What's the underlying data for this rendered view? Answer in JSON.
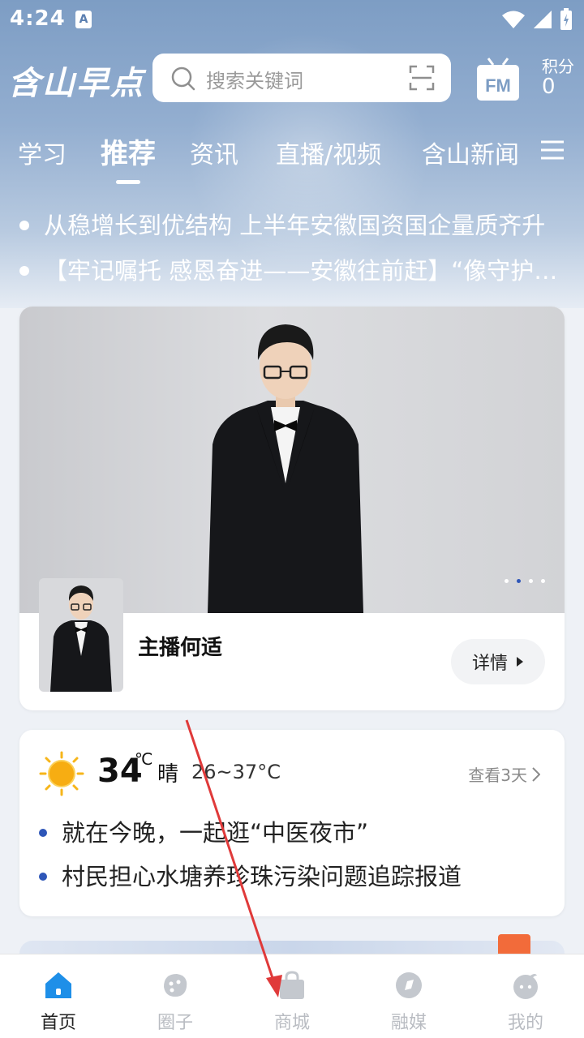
{
  "status_bar": {
    "time": "4:24",
    "app_icon_letter": "A"
  },
  "header": {
    "logo": "含山早点",
    "search_placeholder": "搜索关键词",
    "points_label": "积分",
    "points_value": "0",
    "fm_label": "FM"
  },
  "tabs": [
    {
      "label": "学习",
      "active": false
    },
    {
      "label": "推荐",
      "active": true
    },
    {
      "label": "资讯",
      "active": false
    },
    {
      "label": "直播/视频",
      "active": false
    },
    {
      "label": "含山新闻",
      "active": false
    }
  ],
  "headlines": [
    "从稳增长到优结构 上半年安徽国资国企量质齐升",
    "【牢记嘱托 感恩奋进——安徽往前赶】“像守护眼睛一样"
  ],
  "banner": {
    "anchor_name": "主播何适",
    "detail_label": "详情",
    "dots_count": 4,
    "active_dot": 1
  },
  "weather": {
    "temperature": "34",
    "unit": "℃",
    "condition": "晴",
    "range": "26~37°C",
    "view_more": "查看3天",
    "news": [
      "就在今晚，一起逛“中医夜市”",
      "村民担心水塘养珍珠污染问题追踪报道"
    ]
  },
  "bottom_nav": [
    {
      "label": "首页",
      "icon": "home-icon",
      "active": true
    },
    {
      "label": "圈子",
      "icon": "circle-icon",
      "active": false
    },
    {
      "label": "商城",
      "icon": "shop-bag-icon",
      "active": false
    },
    {
      "label": "融媒",
      "icon": "media-icon",
      "active": false
    },
    {
      "label": "我的",
      "icon": "profile-icon",
      "active": false
    }
  ],
  "colors": {
    "accent_blue": "#2e56b8",
    "home_blue": "#1e8fe8",
    "annotation_red": "#e03a3a"
  }
}
